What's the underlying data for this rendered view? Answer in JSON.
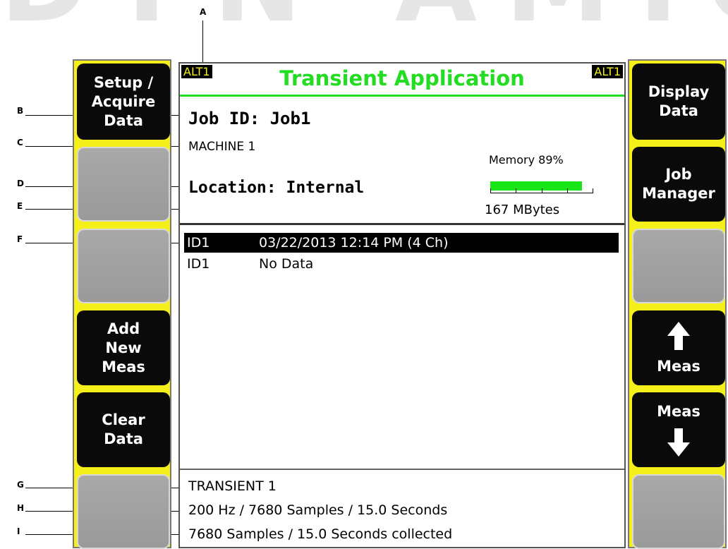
{
  "watermark": "DYN AMIC",
  "callouts": {
    "a": "A",
    "b": "B",
    "c": "C",
    "d": "D",
    "e": "E",
    "f": "F",
    "g": "G",
    "h": "H",
    "i": "I"
  },
  "screen": {
    "alt_left": "ALT1",
    "alt_right": "ALT1",
    "title": "Transient Application",
    "job_id": "Job ID: Job1",
    "machine": "MACHINE 1",
    "location": "Location: Internal",
    "memory_label": "Memory 89%",
    "memory_percent": 89,
    "memory_size": "167 MBytes",
    "measurements": [
      {
        "id": "ID1",
        "info": "03/22/2013  12:14 PM (4 Ch)",
        "selected": true
      },
      {
        "id": "ID1",
        "info": "No Data",
        "selected": false
      }
    ],
    "setup_name": "TRANSIENT 1",
    "setup_params": "200 Hz / 7680 Samples / 15.0 Seconds",
    "setup_status": "7680 Samples / 15.0 Seconds collected"
  },
  "left_softkeys": [
    {
      "label_lines": [
        "Setup /",
        "Acquire",
        "Data"
      ]
    },
    {
      "label_lines": []
    },
    {
      "label_lines": []
    },
    {
      "label_lines": [
        "Add",
        "New",
        "Meas"
      ]
    },
    {
      "label_lines": [
        "Clear",
        "Data"
      ]
    },
    {
      "label_lines": []
    }
  ],
  "right_softkeys": [
    {
      "label_lines": [
        "Display",
        "Data"
      ]
    },
    {
      "label_lines": [
        "Job",
        "Manager"
      ]
    },
    {
      "label_lines": []
    },
    {
      "label": "Meas",
      "icon": "arrow-up-icon"
    },
    {
      "label": "Meas",
      "icon": "arrow-down-icon"
    },
    {
      "label_lines": []
    }
  ],
  "colors": {
    "softkey_frame": "#f6f01a",
    "title_green": "#22dd22",
    "memory_green": "#19e619"
  }
}
